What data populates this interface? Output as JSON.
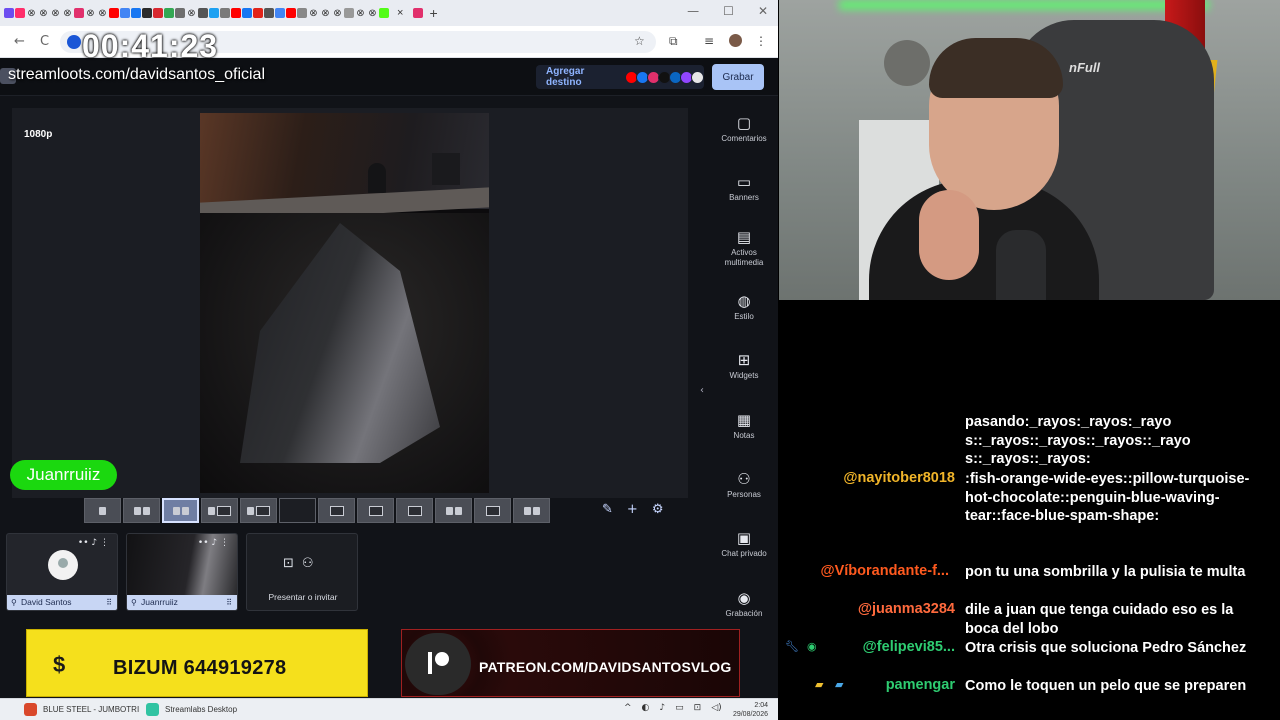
{
  "timer": "00:41:23",
  "browser": {
    "tab_glyphs": [
      "⊗",
      "⊗",
      "⊗",
      "⊗",
      "⊗",
      "⊗",
      "⊗",
      "⊗",
      "⊗",
      "⊗",
      "⊗",
      "⊗"
    ],
    "tab_close": "×",
    "new_tab": "+",
    "window_controls": [
      "—",
      "☐",
      "✕"
    ],
    "nav_back": "←",
    "nav_reload": "C",
    "star": "☆",
    "extensions": "⧉",
    "menu": "⋮"
  },
  "studio": {
    "stream_url": "streamloots.com/davidsantos_oficial",
    "add_destination": "Agregar destino",
    "record_button": "Grabar",
    "resolution": "1080p",
    "guest_name_pill": "Juanrruiiz",
    "side_tools": [
      {
        "icon": "comment-icon",
        "glyph": "▢",
        "label": "Comentarios"
      },
      {
        "icon": "banner-icon",
        "glyph": "▭",
        "label": "Banners"
      },
      {
        "icon": "media-icon",
        "glyph": "▤",
        "label": "Activos multimedia"
      },
      {
        "icon": "palette-icon",
        "glyph": "◍",
        "label": "Estilo"
      },
      {
        "icon": "widgets-icon",
        "glyph": "⊞",
        "label": "Widgets"
      },
      {
        "icon": "notes-icon",
        "glyph": "▦",
        "label": "Notas"
      },
      {
        "icon": "people-icon",
        "glyph": "⚇",
        "label": "Personas"
      },
      {
        "icon": "private-chat-icon",
        "glyph": "▣",
        "label": "Chat privado"
      },
      {
        "icon": "record-icon",
        "glyph": "◉",
        "label": "Grabación"
      }
    ],
    "layout_tools": [
      "✎",
      "+",
      "⚙"
    ],
    "participants": [
      {
        "name": "David Santos"
      },
      {
        "name": "Juanrruiiz"
      }
    ],
    "present_label": "Presentar o invitar"
  },
  "banners": {
    "bizum_symbol": "$",
    "bizum_text": "BIZUM 644919278",
    "patreon_text": "PATREON.COM/DAVIDSANTOSVLOG"
  },
  "taskbar": {
    "apps": [
      "BLUE STEEL - JUMBOTRI",
      "Streamlabs Desktop"
    ],
    "time": "2:04",
    "date": "29/08/2026"
  },
  "webcam": {
    "chair_brand": "nFull"
  },
  "chat": {
    "colors": {
      "nayitober": "#f0b429",
      "viborandante": "#ff5a1f",
      "juanma": "#ff6a3d",
      "felipevi": "#2ecc71",
      "pamengar": "#2ecc71"
    },
    "messages": [
      {
        "user": "",
        "text": "pasando:_rayos:_rayos:_rayo s::_rayos::_rayos::_rayos::_rayo s::_rayos::_rayos:"
      },
      {
        "user": "@nayitober8018",
        "text": ":fish-orange-wide-eyes::pillow-turquoise-hot-chocolate::penguin-blue-waving-tear::face-blue-spam-shape:"
      },
      {
        "user": "@Víborandante-f...",
        "text": "pon tu una sombrilla y la pulisia te multa"
      },
      {
        "user": "@juanma3284",
        "text": "dile a juan que tenga cuidado eso es la boca del lobo"
      },
      {
        "user": "@felipevi85...",
        "text": "Otra crisis que soluciona Pedro Sánchez"
      },
      {
        "user": "pamengar",
        "text": "Como le toquen un pelo que se preparen"
      }
    ]
  }
}
